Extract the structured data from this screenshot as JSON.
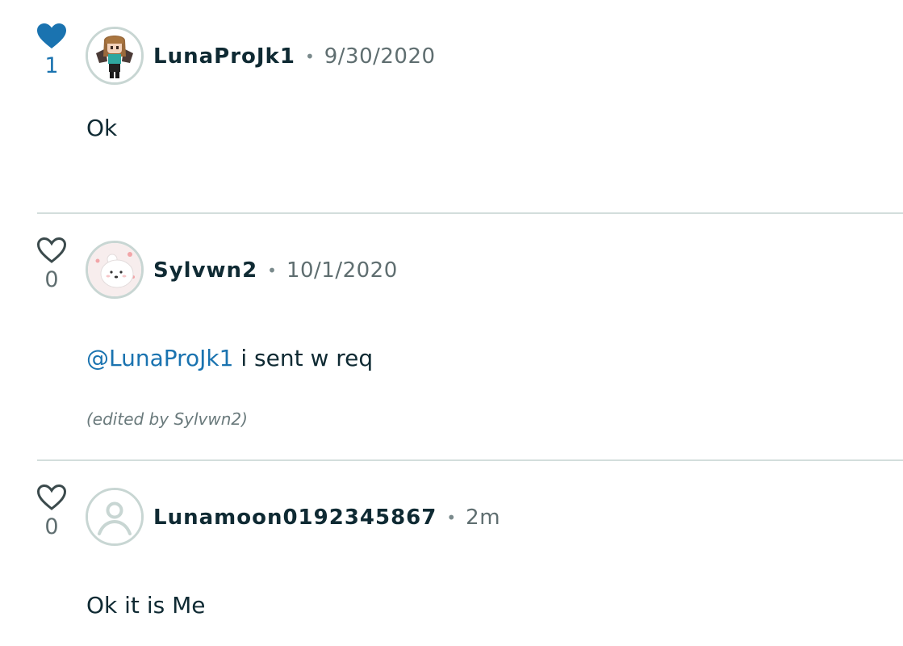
{
  "comments": [
    {
      "likes": "1",
      "liked": true,
      "username": "LunaProJk1",
      "separator": "•",
      "date": "9/30/2020",
      "text": "Ok",
      "avatar_icon": "pixel-character-avatar"
    },
    {
      "likes": "0",
      "liked": false,
      "username": "Sylvwn2",
      "separator": "•",
      "date": "10/1/2020",
      "mention": "@LunaProJk1",
      "text": " i sent w req",
      "edited_note": "(edited by Sylvwn2)",
      "avatar_icon": "polar-bear-avatar"
    },
    {
      "likes": "0",
      "liked": false,
      "username": "Lunamoon0192345867",
      "separator": "•",
      "date": "2m",
      "text": "Ok it is Me",
      "avatar_icon": "default-user-avatar"
    }
  ],
  "colors": {
    "liked_heart": "#1a73b0",
    "unliked_heart": "#3b4a4c",
    "mention": "#1a73b0",
    "divider": "#d3dedc"
  }
}
